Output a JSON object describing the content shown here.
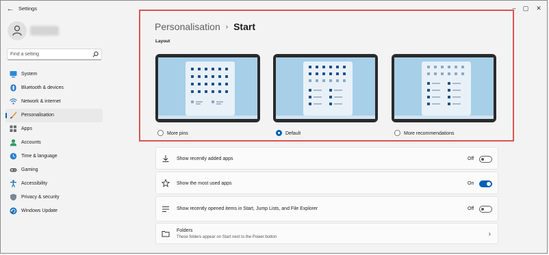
{
  "window": {
    "title": "Settings"
  },
  "search": {
    "placeholder": "Find a setting"
  },
  "sidebar": {
    "items": [
      {
        "label": "System",
        "icon": "system-icon"
      },
      {
        "label": "Bluetooth & devices",
        "icon": "bluetooth-icon"
      },
      {
        "label": "Network & internet",
        "icon": "wifi-icon"
      },
      {
        "label": "Personalisation",
        "icon": "brush-icon",
        "active": true
      },
      {
        "label": "Apps",
        "icon": "apps-icon"
      },
      {
        "label": "Accounts",
        "icon": "accounts-icon"
      },
      {
        "label": "Time & language",
        "icon": "globe-clock-icon"
      },
      {
        "label": "Gaming",
        "icon": "gamepad-icon"
      },
      {
        "label": "Accessibility",
        "icon": "accessibility-icon"
      },
      {
        "label": "Privacy & security",
        "icon": "shield-icon"
      },
      {
        "label": "Windows Update",
        "icon": "update-icon"
      }
    ]
  },
  "header": {
    "breadcrumb_parent": "Personalisation",
    "separator": "›",
    "breadcrumb_current": "Start"
  },
  "layout": {
    "heading": "Layout",
    "options": [
      {
        "label": "More pins",
        "selected": false
      },
      {
        "label": "Default",
        "selected": true
      },
      {
        "label": "More recommendations",
        "selected": false
      }
    ]
  },
  "settings": [
    {
      "label": "Show recently added apps",
      "state": "Off",
      "icon": "download-icon"
    },
    {
      "label": "Show the most used apps",
      "state": "On",
      "icon": "star-icon"
    },
    {
      "label": "Show recently opened items in Start, Jump Lists, and File Explorer",
      "state": "Off",
      "icon": "list-icon"
    },
    {
      "label": "Folders",
      "sublabel": "These folders appear on Start next to the Power button",
      "icon": "folder-icon"
    }
  ],
  "colors": {
    "accent": "#005fb8",
    "highlight_border": "#d9534f",
    "wallpaper": "#a7cfe8"
  }
}
